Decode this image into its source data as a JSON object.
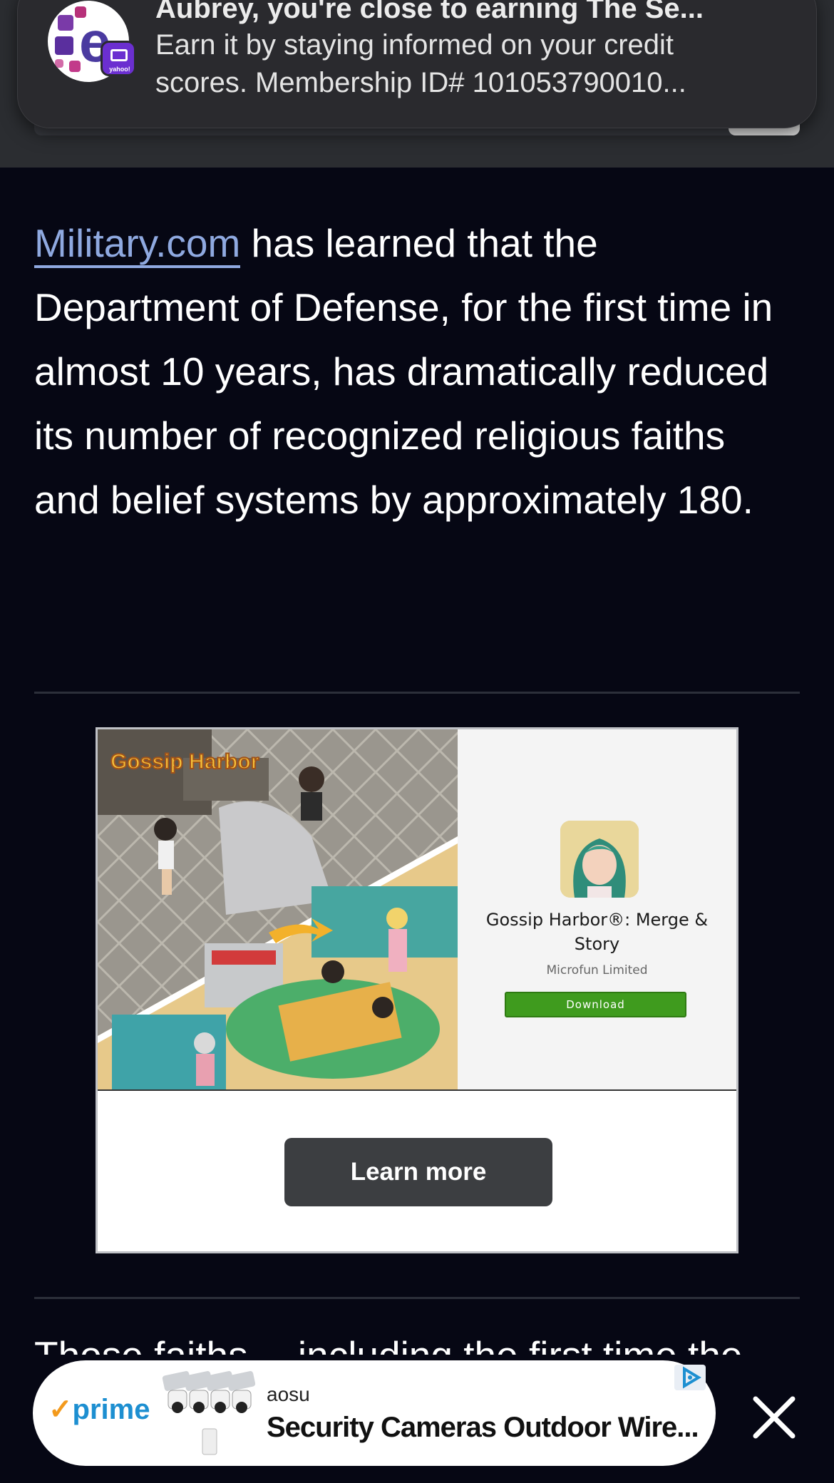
{
  "notification": {
    "title": "Aubrey, you're close to earning The Se...",
    "body_line1": "Earn it by staying informed on your credit",
    "body_line2": "scores. Membership ID# 101053790010...",
    "badge_text": "yahoo!",
    "icon": "experian-e-icon",
    "badge_icon": "yahoo-mail-icon"
  },
  "article": {
    "link_text": "Military.com",
    "paragraph_rest": " has learned that the Department of Defense, for the first time in almost 10 years, has dramatically reduced its number of recognized religious faiths and belief systems by approximately 180.",
    "next_paragraph_partial": "Those faiths… including the first time the list"
  },
  "ad": {
    "game_logo_text": "Gossip Harbor",
    "app_name": "Gossip Harbor®: Merge & Story",
    "developer": "Microfun Limited",
    "download_label": "Download",
    "learn_more_label": "Learn more"
  },
  "bottom_ad": {
    "prime_label": "prime",
    "brand": "aosu",
    "title": "Security Cameras Outdoor Wire...",
    "close_icon": "close-icon",
    "adchoices_icon": "adchoices-icon"
  },
  "colors": {
    "background": "#060714",
    "link": "#8fa9e0",
    "download_button": "#3f9b1e",
    "learn_more_button": "#3c3e41",
    "prime_blue": "#1d8fd1"
  }
}
